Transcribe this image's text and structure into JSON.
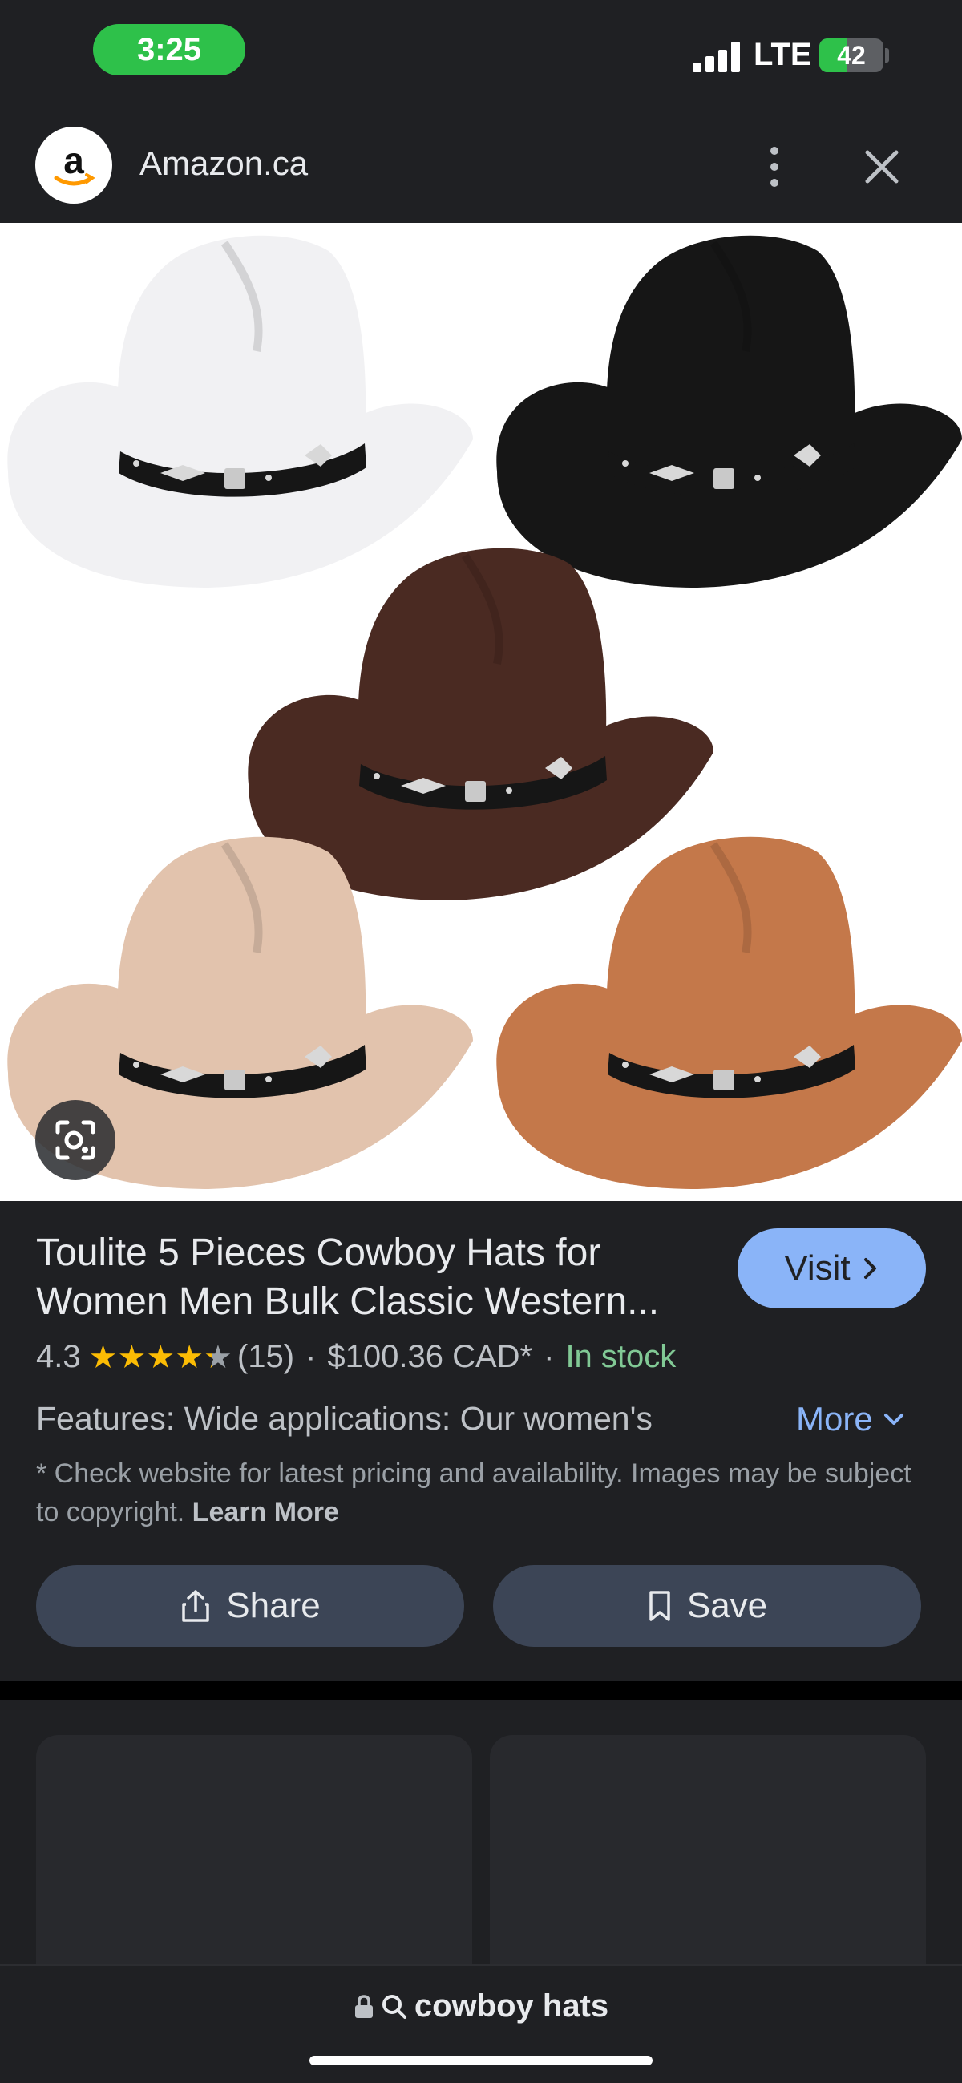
{
  "status_bar": {
    "time": "3:25",
    "network": "LTE",
    "battery_level": "42",
    "battery_fraction": 0.42
  },
  "header": {
    "site_name": "Amazon.ca",
    "logo_letter": "a"
  },
  "image": {
    "hat_colors": [
      "#f1f1f3",
      "#161616",
      "#4a2a22",
      "#e2c3ad",
      "#c4784a"
    ]
  },
  "product": {
    "title": "Toulite 5 Pieces Cowboy Hats for Women Men Bulk Classic Western...",
    "visit_label": "Visit",
    "rating": "4.3",
    "rating_value": 4.3,
    "review_count": "(15)",
    "separator": "·",
    "price": "$100.36 CAD*",
    "availability": "In stock",
    "features": "Features: Wide applications: Our women's",
    "more_label": "More",
    "disclaimer": "* Check website for latest pricing and availability. Images may be subject to copyright.",
    "learn_more": "Learn More",
    "share_label": "Share",
    "save_label": "Save"
  },
  "search": {
    "query": "cowboy hats"
  },
  "colors": {
    "background": "#1f2023",
    "accent": "#8ab4f8",
    "in_stock": "#81c995",
    "star": "#fbbc04",
    "status_green": "#2ec14a"
  }
}
